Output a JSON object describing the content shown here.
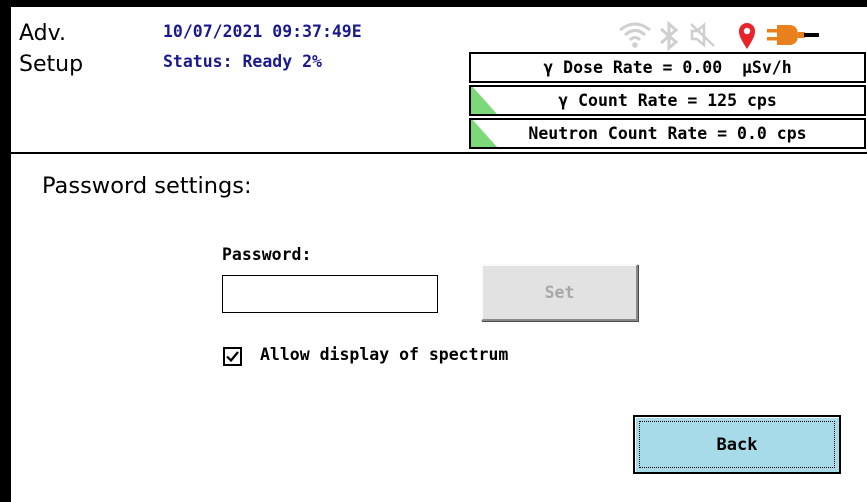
{
  "header": {
    "title_line1": "Adv.",
    "title_line2": "Setup",
    "datetime": "10/07/2021 09:37:49E",
    "status": "Status: Ready 2%",
    "icons": [
      "wifi-icon",
      "bluetooth-icon",
      "speaker-muted-icon",
      "location-pin-icon",
      "power-plug-icon"
    ],
    "location_pin_color": "#e8242a",
    "plug_color": "#e8801e"
  },
  "rates": {
    "dose_rate": "γ Dose Rate = 0.00  μSv/h",
    "gamma_count_rate": "γ Count Rate = 125 cps",
    "neutron_count_rate": "Neutron Count Rate = 0.0 cps",
    "indicator_color": "#7dd87a"
  },
  "main": {
    "section_title": "Password settings:",
    "password_label": "Password:",
    "password_value": "",
    "set_button_label": "Set",
    "allow_spectrum_label": "Allow display of spectrum",
    "allow_spectrum_checked": true,
    "back_button_label": "Back",
    "back_button_color": "#a8dbe9"
  }
}
